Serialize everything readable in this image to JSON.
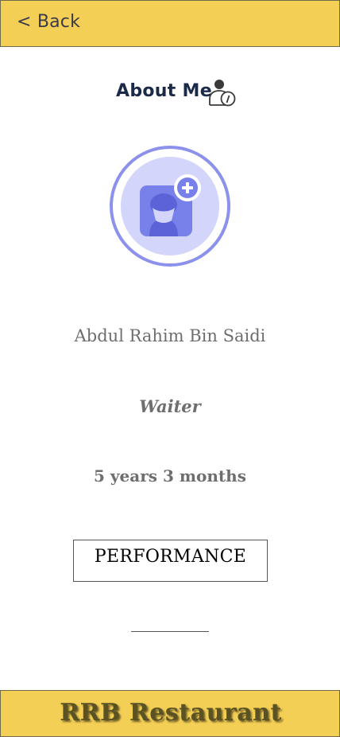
{
  "header": {
    "back_label": "< Back"
  },
  "about": {
    "title": "About Me",
    "icon": "user-info-icon"
  },
  "profile": {
    "avatar_icon": "add-user-photo-icon",
    "name": "Abdul Rahim Bin Saidi",
    "role": "Waiter",
    "tenure": "5 years 3 months"
  },
  "actions": {
    "performance_label": "PERFORMANCE"
  },
  "footer": {
    "brand": "RRB Restaurant"
  },
  "colors": {
    "bar_background": "#f4cf55",
    "avatar_accent": "#7a84e8",
    "avatar_light": "#d8dbff",
    "text_muted": "#6e6e6e",
    "title_navy": "#1c2a4a"
  }
}
